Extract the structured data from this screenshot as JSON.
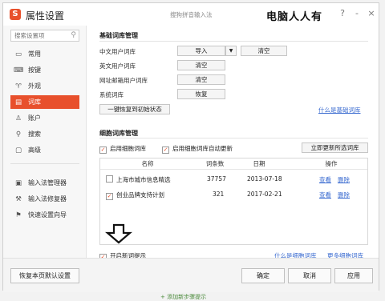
{
  "window": {
    "title": "属性设置",
    "center_title": "搜狗拼音输入法",
    "watermark": "电脑人人有",
    "help_label": "?",
    "minimize_label": "-",
    "close_label": "×"
  },
  "sidebar": {
    "search_placeholder": "搜索设置项",
    "items": [
      {
        "label": "常用",
        "icon": "monitor-icon"
      },
      {
        "label": "按键",
        "icon": "keyboard-icon"
      },
      {
        "label": "外观",
        "icon": "shirt-icon"
      },
      {
        "label": "词库",
        "icon": "book-icon",
        "active": true
      },
      {
        "label": "账户",
        "icon": "user-icon"
      },
      {
        "label": "搜索",
        "icon": "search-icon"
      },
      {
        "label": "高级",
        "icon": "advanced-icon"
      },
      {
        "label": "输入法管理器",
        "icon": "manager-icon"
      },
      {
        "label": "输入法修复器",
        "icon": "repair-icon"
      },
      {
        "label": "快速设置向导",
        "icon": "wizard-icon"
      }
    ]
  },
  "basic": {
    "heading": "基础词库管理",
    "rows": [
      {
        "label": "中文用户词库",
        "button": "导入",
        "button2": "清空"
      },
      {
        "label": "英文用户词库",
        "button": "清空"
      },
      {
        "label": "网址邮箱用户词库",
        "button": "清空"
      },
      {
        "label": "系统词库",
        "button": "恢复"
      }
    ],
    "reset_button": "一键恢复到初始状态",
    "help_link": "什么是基础词库"
  },
  "cell": {
    "heading": "细胞词库管理",
    "enable_label": "启用细胞词库",
    "auto_update_label": "启用细胞词库自动更新",
    "update_button": "立即更新所选词库",
    "columns": [
      "名称",
      "词条数",
      "日期",
      "操作"
    ],
    "rows": [
      {
        "checked": false,
        "name": "上海市城市信息精选",
        "count": "37757",
        "date": "2013-07-18",
        "view": "查看",
        "delete": "删除"
      },
      {
        "checked": true,
        "name": "创业品牌支持计划",
        "count": "321",
        "date": "2017-02-21",
        "view": "查看",
        "delete": "删除"
      }
    ],
    "new_word_hint": "开启新词提示",
    "link_what": "什么是细胞词库",
    "link_more": "更多细胞词库"
  },
  "footer": {
    "restore_button": "恢复本页默认设置",
    "ok_button": "确定",
    "cancel_button": "取消",
    "apply_button": "应用",
    "strip_text": "+ 添加新步骤提示"
  },
  "colors": {
    "accent": "#e8502c",
    "link": "#3a6bd0"
  }
}
